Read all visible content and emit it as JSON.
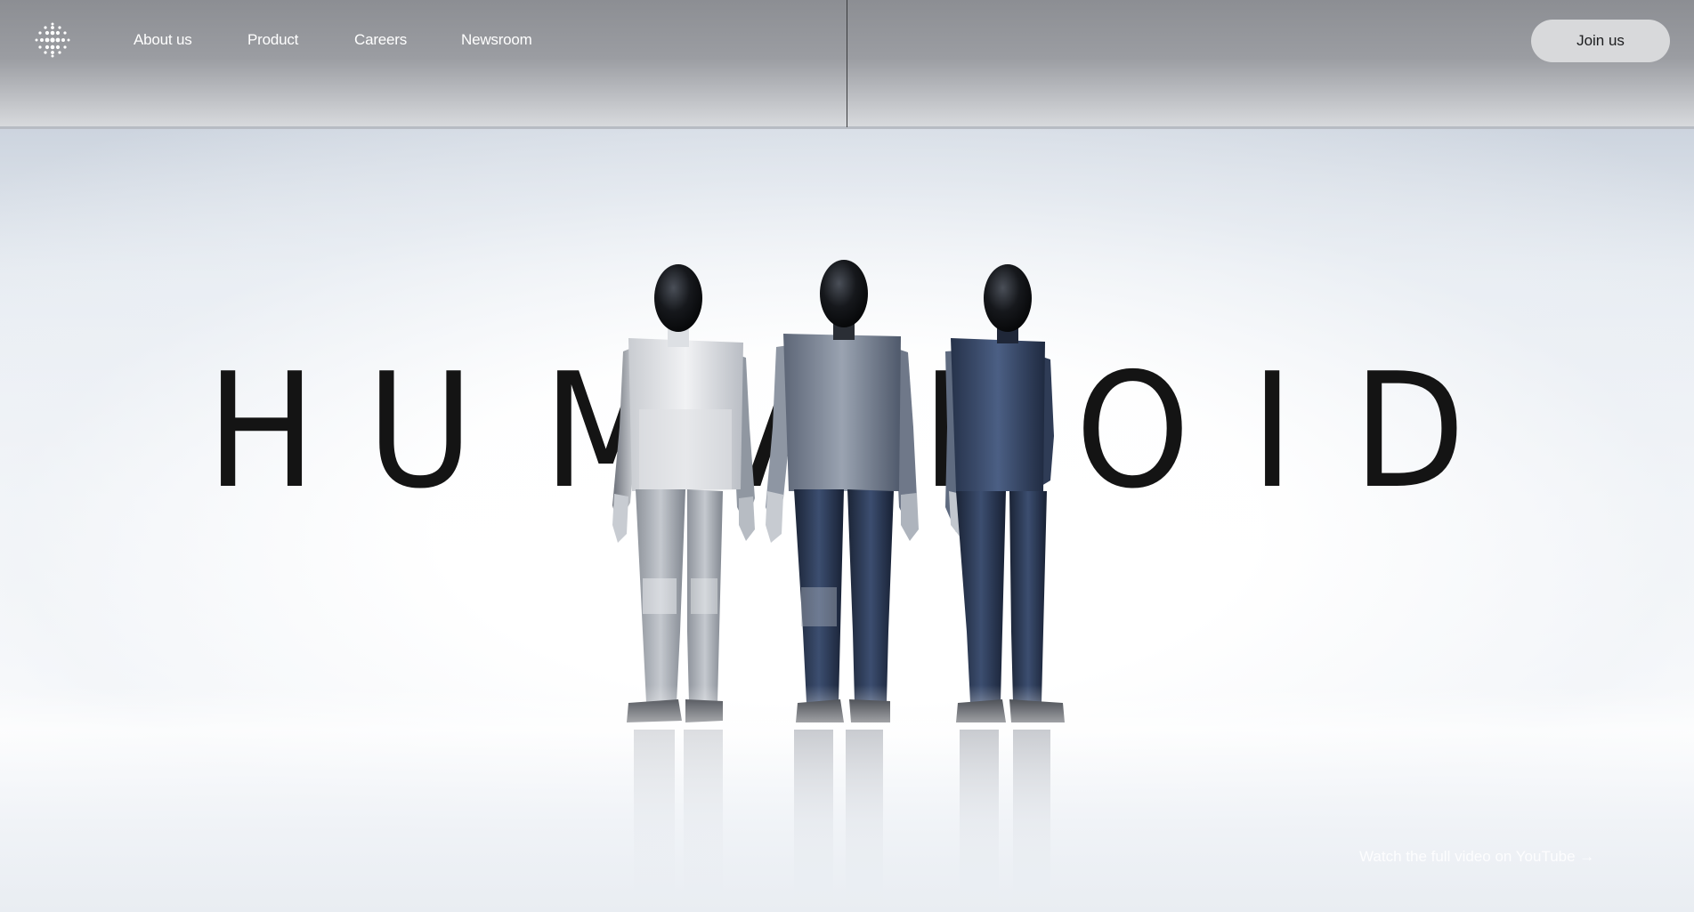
{
  "header": {
    "logo_icon": "dot-grid-logo-icon",
    "nav": [
      {
        "label": "About us"
      },
      {
        "label": "Product"
      },
      {
        "label": "Careers"
      },
      {
        "label": "Newsroom"
      }
    ],
    "cta_label": "Join us"
  },
  "hero": {
    "title_letters": [
      "H",
      "U",
      "M",
      "A",
      "N",
      "O",
      "I",
      "D"
    ],
    "image_description_icon": "humanoid-robots-image",
    "watch_link": "Watch the full video on YouTube →"
  },
  "colors": {
    "accent_dark": "#141414",
    "button_bg": "#d8d9db",
    "robot_white": "#e7e9ec",
    "robot_grey": "#7b8595",
    "robot_blue": "#3c4f70"
  }
}
